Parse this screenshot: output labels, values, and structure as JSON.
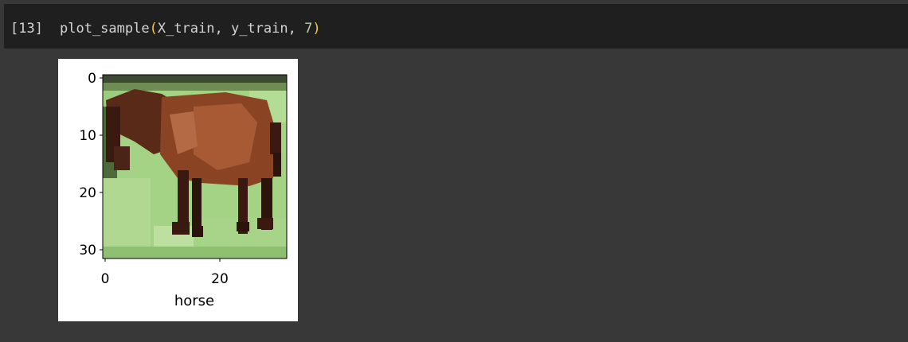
{
  "cell": {
    "exec_count": "[13]",
    "code": {
      "function": "plot_sample",
      "open_paren": "(",
      "args": "X_train, y_train, ",
      "number": "7",
      "close_paren": ")"
    }
  },
  "output": {
    "image_label": "horse",
    "y_ticks": [
      "0",
      "10",
      "20",
      "30"
    ],
    "x_ticks": [
      "0",
      "20"
    ],
    "image_description": "pixelated horse on green grass"
  },
  "colors": {
    "page_bg": "#383838",
    "cell_bg": "#1f1f1f",
    "paren": "#f2c94c",
    "number": "#b5cea8"
  }
}
